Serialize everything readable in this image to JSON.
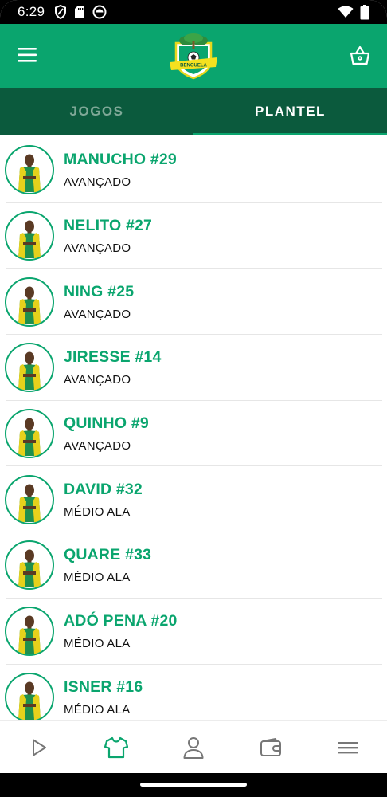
{
  "status_bar": {
    "time": "6:29"
  },
  "app_bar": {
    "logo_text": "BENGUELA",
    "accent_color": "#0aa56e"
  },
  "tabs": [
    {
      "label": "JOGOS",
      "active": false
    },
    {
      "label": "PLANTEL",
      "active": true
    }
  ],
  "players": [
    {
      "name": "MANUCHO #29",
      "position": "AVANÇADO"
    },
    {
      "name": "NELITO #27",
      "position": "AVANÇADO"
    },
    {
      "name": "NING #25",
      "position": "AVANÇADO"
    },
    {
      "name": "JIRESSE #14",
      "position": "AVANÇADO"
    },
    {
      "name": "QUINHO #9",
      "position": "AVANÇADO"
    },
    {
      "name": "DAVID #32",
      "position": "MÉDIO ALA"
    },
    {
      "name": "QUARE #33",
      "position": "MÉDIO ALA"
    },
    {
      "name": "ADÓ PENA #20",
      "position": "MÉDIO ALA"
    },
    {
      "name": "ISNER #16",
      "position": "MÉDIO ALA"
    }
  ],
  "bottom_nav": [
    {
      "icon": "play-icon",
      "active": false
    },
    {
      "icon": "shirt-icon",
      "active": true
    },
    {
      "icon": "person-icon",
      "active": false
    },
    {
      "icon": "wallet-icon",
      "active": false
    },
    {
      "icon": "menu-icon",
      "active": false
    }
  ]
}
